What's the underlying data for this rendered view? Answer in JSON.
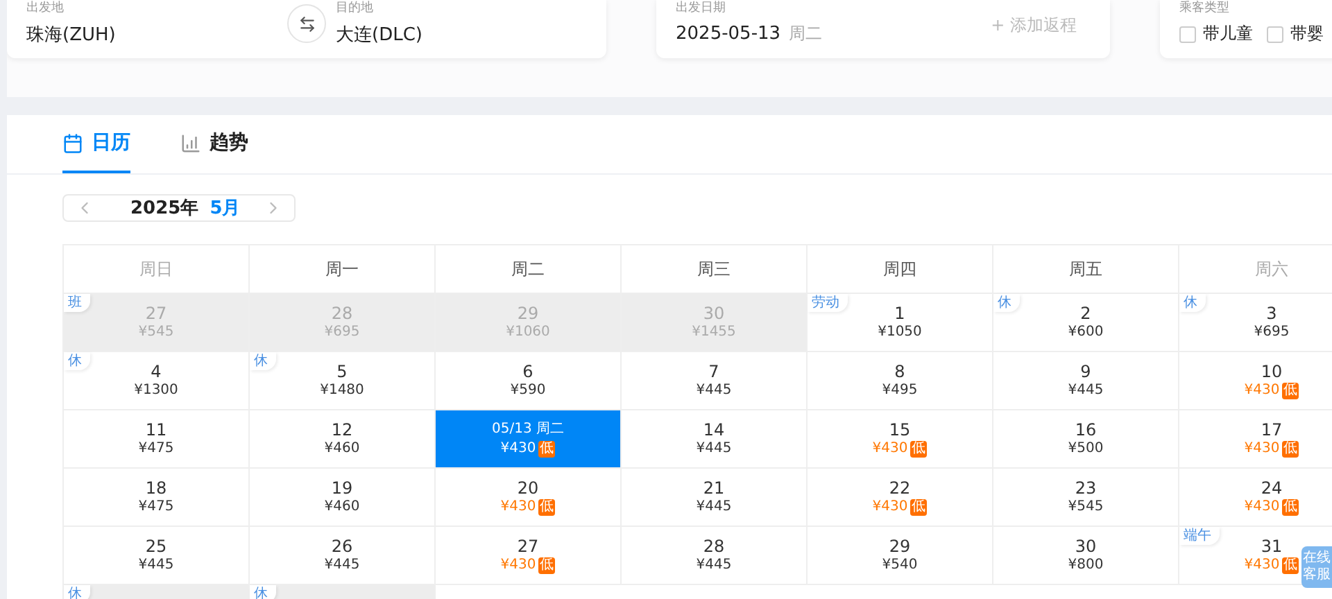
{
  "search": {
    "origin": {
      "label": "出发地",
      "value": "珠海(ZUH)"
    },
    "destination": {
      "label": "目的地",
      "value": "大连(DLC)"
    },
    "date": {
      "label": "出发日期",
      "value": "2025-05-13",
      "weekday": "周二",
      "return_link": "+ 添加返程"
    },
    "passengers": {
      "label": "乘客类型",
      "options": [
        {
          "label": "带儿童",
          "checked": false
        },
        {
          "label": "带婴",
          "checked": false
        }
      ]
    }
  },
  "tabs": [
    {
      "label": "日历",
      "kind": "calendar",
      "selected": true
    },
    {
      "label": "趋势",
      "kind": "trend",
      "selected": false
    }
  ],
  "month_nav": {
    "year": "2025年",
    "month": "5月"
  },
  "calendar": {
    "weekdays": [
      {
        "label": "周日",
        "weekend": true
      },
      {
        "label": "周一",
        "weekend": false
      },
      {
        "label": "周二",
        "weekend": false
      },
      {
        "label": "周三",
        "weekend": false
      },
      {
        "label": "周四",
        "weekend": false
      },
      {
        "label": "周五",
        "weekend": false
      },
      {
        "label": "周六",
        "weekend": true
      }
    ],
    "rows": [
      [
        {
          "day": "27",
          "price": "¥545",
          "dim": true,
          "selected": false,
          "tag": "班"
        },
        {
          "day": "28",
          "price": "¥695",
          "dim": true,
          "selected": false
        },
        {
          "day": "29",
          "price": "¥1060",
          "dim": true,
          "selected": false
        },
        {
          "day": "30",
          "price": "¥1455",
          "dim": true,
          "selected": false
        },
        {
          "day": "1",
          "price": "¥1050",
          "dim": false,
          "selected": false,
          "tag": "劳动"
        },
        {
          "day": "2",
          "price": "¥600",
          "dim": false,
          "selected": false,
          "tag": "休"
        },
        {
          "day": "3",
          "price": "¥695",
          "dim": false,
          "selected": false,
          "tag": "休"
        }
      ],
      [
        {
          "day": "4",
          "price": "¥1300",
          "dim": false,
          "selected": false,
          "tag": "休"
        },
        {
          "day": "5",
          "price": "¥1480",
          "dim": false,
          "selected": false,
          "tag": "休"
        },
        {
          "day": "6",
          "price": "¥590",
          "dim": false,
          "selected": false
        },
        {
          "day": "7",
          "price": "¥445",
          "dim": false,
          "selected": false
        },
        {
          "day": "8",
          "price": "¥495",
          "dim": false,
          "selected": false
        },
        {
          "day": "9",
          "price": "¥445",
          "dim": false,
          "selected": false
        },
        {
          "day": "10",
          "price": "¥430",
          "badge": "低",
          "dim": false,
          "selected": false
        }
      ],
      [
        {
          "day": "11",
          "price": "¥475",
          "dim": false,
          "selected": false
        },
        {
          "day": "12",
          "price": "¥460",
          "dim": false,
          "selected": false
        },
        {
          "day": "05/13 周二",
          "price": "¥430",
          "badge": "低",
          "dim": false,
          "selected": true
        },
        {
          "day": "14",
          "price": "¥445",
          "dim": false,
          "selected": false
        },
        {
          "day": "15",
          "price": "¥430",
          "badge": "低",
          "dim": false,
          "selected": false
        },
        {
          "day": "16",
          "price": "¥500",
          "dim": false,
          "selected": false
        },
        {
          "day": "17",
          "price": "¥430",
          "badge": "低",
          "dim": false,
          "selected": false
        }
      ],
      [
        {
          "day": "18",
          "price": "¥475",
          "dim": false,
          "selected": false
        },
        {
          "day": "19",
          "price": "¥460",
          "dim": false,
          "selected": false
        },
        {
          "day": "20",
          "price": "¥430",
          "badge": "低",
          "dim": false,
          "selected": false
        },
        {
          "day": "21",
          "price": "¥445",
          "dim": false,
          "selected": false
        },
        {
          "day": "22",
          "price": "¥430",
          "badge": "低",
          "dim": false,
          "selected": false
        },
        {
          "day": "23",
          "price": "¥545",
          "dim": false,
          "selected": false
        },
        {
          "day": "24",
          "price": "¥430",
          "badge": "低",
          "dim": false,
          "selected": false
        }
      ],
      [
        {
          "day": "25",
          "price": "¥445",
          "dim": false,
          "selected": false
        },
        {
          "day": "26",
          "price": "¥445",
          "dim": false,
          "selected": false
        },
        {
          "day": "27",
          "price": "¥430",
          "badge": "低",
          "dim": false,
          "selected": false
        },
        {
          "day": "28",
          "price": "¥445",
          "dim": false,
          "selected": false
        },
        {
          "day": "29",
          "price": "¥540",
          "dim": false,
          "selected": false
        },
        {
          "day": "30",
          "price": "¥800",
          "dim": false,
          "selected": false
        },
        {
          "day": "31",
          "price": "¥430",
          "badge": "低",
          "dim": false,
          "selected": false,
          "tag": "端午"
        }
      ],
      [
        {
          "dim": true,
          "selected": false,
          "tag": "休"
        },
        {
          "dim": true,
          "selected": false,
          "tag": "休"
        }
      ]
    ]
  },
  "service_button": {
    "label": "在线客服"
  }
}
